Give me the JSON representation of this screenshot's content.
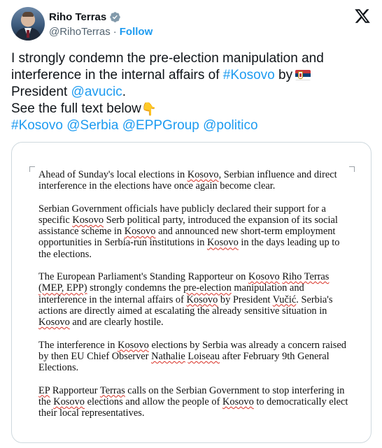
{
  "author": {
    "display_name": "Riho Terras",
    "handle": "@RihoTerras",
    "separator": "·",
    "follow_label": "Follow"
  },
  "tweet": {
    "l1": "I strongly condemn the pre-election manipulation and",
    "l2_text": "interference in the internal affairs of ",
    "l2_tag": "#Kosovo",
    "l2_after": " by",
    "l3_text": "President ",
    "l3_mention": "@avucic",
    "l3_after": ".",
    "l4_text": "See the full text below",
    "tag_kosovo": "#Kosovo",
    "tag_serbia": "@Serbia",
    "tag_epp": "@EPPGroup",
    "tag_politico": "@politico",
    "flag_emoji": "serbia-flag-icon",
    "pointing_emoji": "👇"
  },
  "document": {
    "p1": [
      {
        "t": "Ahead of Sunday's local elections in "
      },
      {
        "s": "Kosovo"
      },
      {
        "t": ", Serbian influence and direct"
      },
      {
        "br": true
      },
      {
        "t": "interference in the elections have once again become clear."
      }
    ],
    "p2": [
      {
        "t": "Serbian Government officials have publicly declared their support for a"
      },
      {
        "br": true
      },
      {
        "t": "specific "
      },
      {
        "s": "Kosovo"
      },
      {
        "t": " Serb political party, introduced the expansion of its social"
      },
      {
        "br": true
      },
      {
        "t": "assistance scheme in "
      },
      {
        "s": "Kosovo"
      },
      {
        "t": " and announced new short-term employment"
      },
      {
        "br": true
      },
      {
        "t": "opportunities in Serbia-run institutions in "
      },
      {
        "s": "Kosovo"
      },
      {
        "t": " in the days leading up to"
      },
      {
        "br": true
      },
      {
        "t": "the elections."
      }
    ],
    "p3": [
      {
        "t": " The European Parliament's Standing Rapporteur on "
      },
      {
        "s": "Kosovo"
      },
      {
        "t": " "
      },
      {
        "s": "Riho Terras"
      },
      {
        "br": true
      },
      {
        "s": "(MEP, EPP)"
      },
      {
        "t": " strongly condemns the "
      },
      {
        "s": "pre-election"
      },
      {
        "t": " manipulation and"
      },
      {
        "br": true
      },
      {
        "t": "interference in the internal affairs of "
      },
      {
        "s": "Kosovo"
      },
      {
        "t": " by President "
      },
      {
        "s": "Vučić"
      },
      {
        "t": ". Serbia's"
      },
      {
        "br": true
      },
      {
        "t": "actions are directly aimed at escalating the already sensitive situation in"
      },
      {
        "br": true
      },
      {
        "s": "Kosovo"
      },
      {
        "t": " and are clearly hostile."
      }
    ],
    "p4": [
      {
        "t": "The interference in "
      },
      {
        "s": "Kosovo"
      },
      {
        "t": " elections by Serbia was already a concern raised"
      },
      {
        "br": true
      },
      {
        "t": "by then EU Chief Observer "
      },
      {
        "s": "Nathalie"
      },
      {
        "t": " "
      },
      {
        "s": "Loiseau"
      },
      {
        "t": " after February 9th General"
      },
      {
        "br": true
      },
      {
        "t": "Elections."
      }
    ],
    "p5": [
      {
        "s": "EP"
      },
      {
        "t": " Rapporteur "
      },
      {
        "s": "Terras"
      },
      {
        "t": " calls on the Serbian Government to stop interfering in"
      },
      {
        "br": true
      },
      {
        "t": "the "
      },
      {
        "s": "Kosovo"
      },
      {
        "t": " elections and allow the people of "
      },
      {
        "s": "Kosovo"
      },
      {
        "t": " to democratically elect"
      },
      {
        "br": true
      },
      {
        "t": "their local representatives."
      }
    ]
  }
}
